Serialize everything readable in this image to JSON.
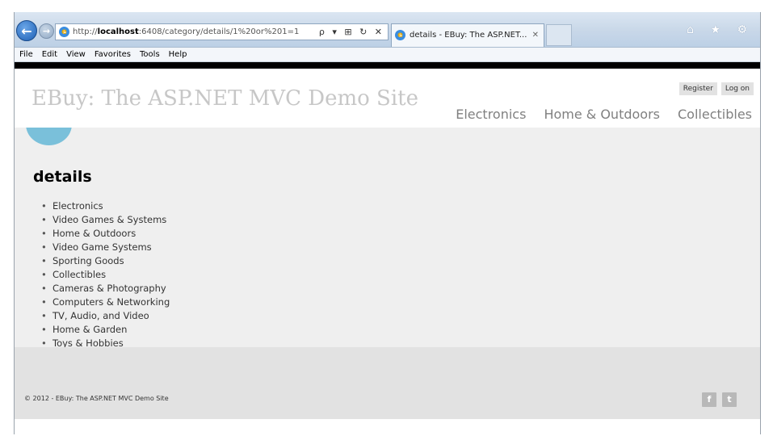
{
  "browser": {
    "address_prefix": "http://",
    "address_host": "localhost",
    "address_rest": ":6408/category/details/1%20or%201=1",
    "address_icons": "ρ ▾ ⊞ ↻ ✕",
    "tab_title": "details - EBuy: The ASP.NET...",
    "tab_close": "✕",
    "back_glyph": "←",
    "forward_glyph": "→",
    "top_icons": "⌂ ★ ⚙",
    "menu": [
      "File",
      "Edit",
      "View",
      "Favorites",
      "Tools",
      "Help"
    ]
  },
  "site": {
    "title": "EBuy: The ASP.NET MVC Demo Site",
    "register": "Register",
    "login": "Log on",
    "menu": [
      "Electronics",
      "Home & Outdoors",
      "Collectibles"
    ],
    "accent_color": "#7ac0da"
  },
  "page": {
    "heading": "details",
    "categories": [
      "Electronics",
      "Video Games & Systems",
      "Home & Outdoors",
      "Video Game Systems",
      "Sporting Goods",
      "Collectibles",
      "Cameras & Photography",
      "Computers & Networking",
      "TV, Audio, and Video",
      "Home & Garden",
      "Toys & Hobbies"
    ]
  },
  "footer": {
    "copyright": "© 2012 - EBuy: The ASP.NET MVC Demo Site",
    "facebook_glyph": "f",
    "twitter_glyph": "t"
  }
}
